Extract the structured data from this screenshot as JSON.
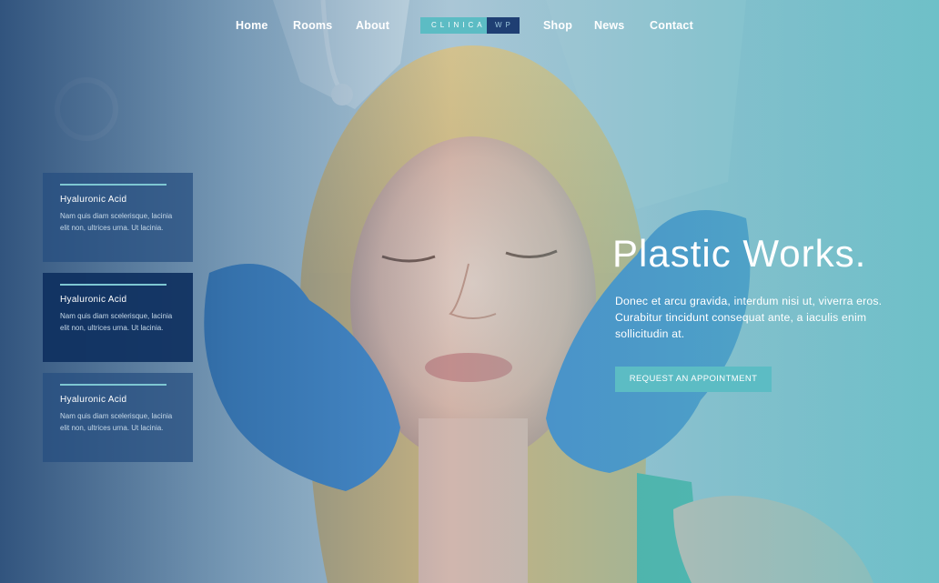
{
  "nav": {
    "items": [
      "Home",
      "Rooms",
      "About",
      "Shop",
      "News",
      "Contact"
    ],
    "logo": {
      "part1": "CLINICA",
      "part2": "WP"
    }
  },
  "cards": [
    {
      "title": "Hyaluronic Acid",
      "text": "Nam quis diam scelerisque, lacinia elit non, ultrices urna. Ut lacinia."
    },
    {
      "title": "Hyaluronic Acid",
      "text": "Nam quis diam scelerisque, lacinia elit non, ultrices urna. Ut lacinia."
    },
    {
      "title": "Hyaluronic Acid",
      "text": "Nam quis diam scelerisque, lacinia elit non, ultrices urna. Ut lacinia."
    }
  ],
  "hero": {
    "headline": "Plastic Works.",
    "subtext": "Donec et arcu gravida, interdum nisi ut, viverra eros. Curabitur tincidunt consequat ante, a iaculis enim sollicitudin at.",
    "cta_label": "REQUEST AN APPOINTMENT"
  },
  "colors": {
    "accent": "#5cbcc4",
    "navy": "#1f3f73",
    "card_active": "#0e3060"
  }
}
